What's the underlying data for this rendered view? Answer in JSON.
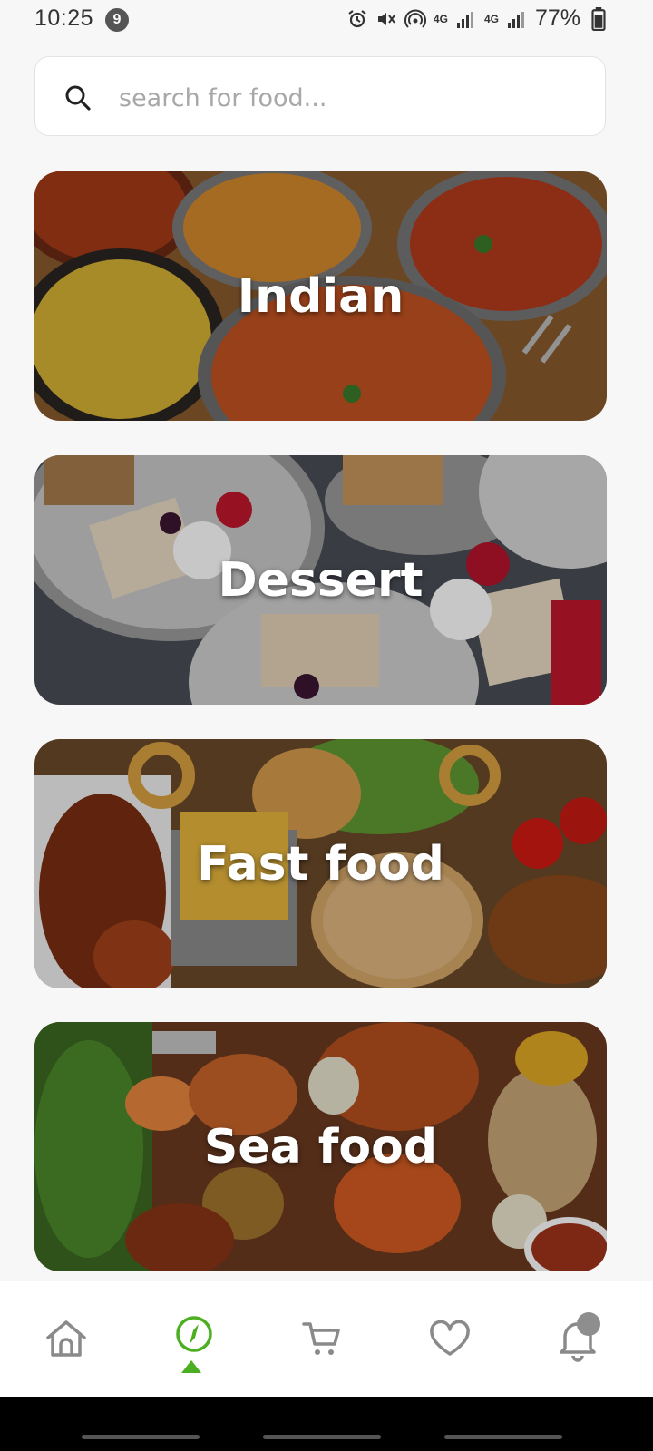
{
  "status_bar": {
    "time": "10:25",
    "notification_count": "9",
    "network_1": "4G",
    "network_2": "4G",
    "battery": "77%"
  },
  "search": {
    "placeholder": "search for food..."
  },
  "categories": [
    {
      "label": "Indian"
    },
    {
      "label": "Dessert"
    },
    {
      "label": "Fast food"
    },
    {
      "label": "Sea food"
    }
  ],
  "bottom_nav": {
    "items": [
      {
        "icon": "home-icon",
        "active": false
      },
      {
        "icon": "compass-icon",
        "active": true
      },
      {
        "icon": "cart-icon",
        "active": false
      },
      {
        "icon": "heart-icon",
        "active": false
      },
      {
        "icon": "bell-icon",
        "active": false
      }
    ],
    "accent_color": "#4caf22"
  }
}
